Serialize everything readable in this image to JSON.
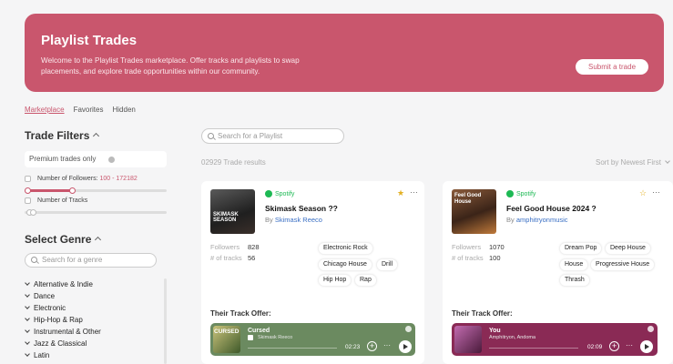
{
  "banner": {
    "title": "Playlist Trades",
    "description": "Welcome to the Playlist Trades marketplace. Offer tracks and playlists to swap placements, and explore trade opportunities within our community.",
    "submit_label": "Submit a trade"
  },
  "tabs": [
    {
      "label": "Marketplace",
      "active": true
    },
    {
      "label": "Favorites",
      "active": false
    },
    {
      "label": "Hidden",
      "active": false
    }
  ],
  "filters": {
    "title": "Trade Filters",
    "premium_label": "Premium trades only",
    "followers_label": "Number of Followers:",
    "followers_range": "100 - 172182",
    "tracks_label": "Number of Tracks"
  },
  "genre": {
    "title": "Select Genre",
    "search_placeholder": "Search for a genre",
    "items": [
      "Alternative & Indie",
      "Dance",
      "Electronic",
      "Hip-Hop & Rap",
      "Instrumental & Other",
      "Jazz & Classical",
      "Latin"
    ]
  },
  "search": {
    "placeholder": "Search for a Playlist"
  },
  "results_text": "02929 Trade results",
  "sort_label": "Sort by Newest First",
  "cards": [
    {
      "platform": "Spotify",
      "cover_text": "SKIMASK SEASON",
      "title": "Skimask Season ??",
      "by": "By",
      "user": "Skimask Reeco",
      "favorited": true,
      "followers_label": "Followers",
      "followers": "828",
      "tracks_label": "# of tracks",
      "tracks": "56",
      "tags": [
        "Electronic Rock",
        "Chicago House",
        "Drill",
        "Hip Hop",
        "Rap"
      ],
      "offer_label": "Their Track Offer:",
      "track": {
        "name": "Cursed",
        "artist": "Skimask Reeco",
        "time": "02:23",
        "thumb_text": "CURSED",
        "color": "#6b8a60"
      }
    },
    {
      "platform": "Spotify",
      "cover_text": "Feel Good House",
      "title": "Feel Good House 2024 ?",
      "by": "By",
      "user": "amphitryonmusic",
      "favorited": false,
      "followers_label": "Followers",
      "followers": "1070",
      "tracks_label": "# of tracks",
      "tracks": "100",
      "tags": [
        "Dream Pop",
        "Deep House",
        "House",
        "Progressive House",
        "Thrash"
      ],
      "offer_label": "Their Track Offer:",
      "track": {
        "name": "You",
        "artist": "Amphitryon, Andoma",
        "time": "02:09",
        "color": "#8a2a55"
      }
    }
  ]
}
